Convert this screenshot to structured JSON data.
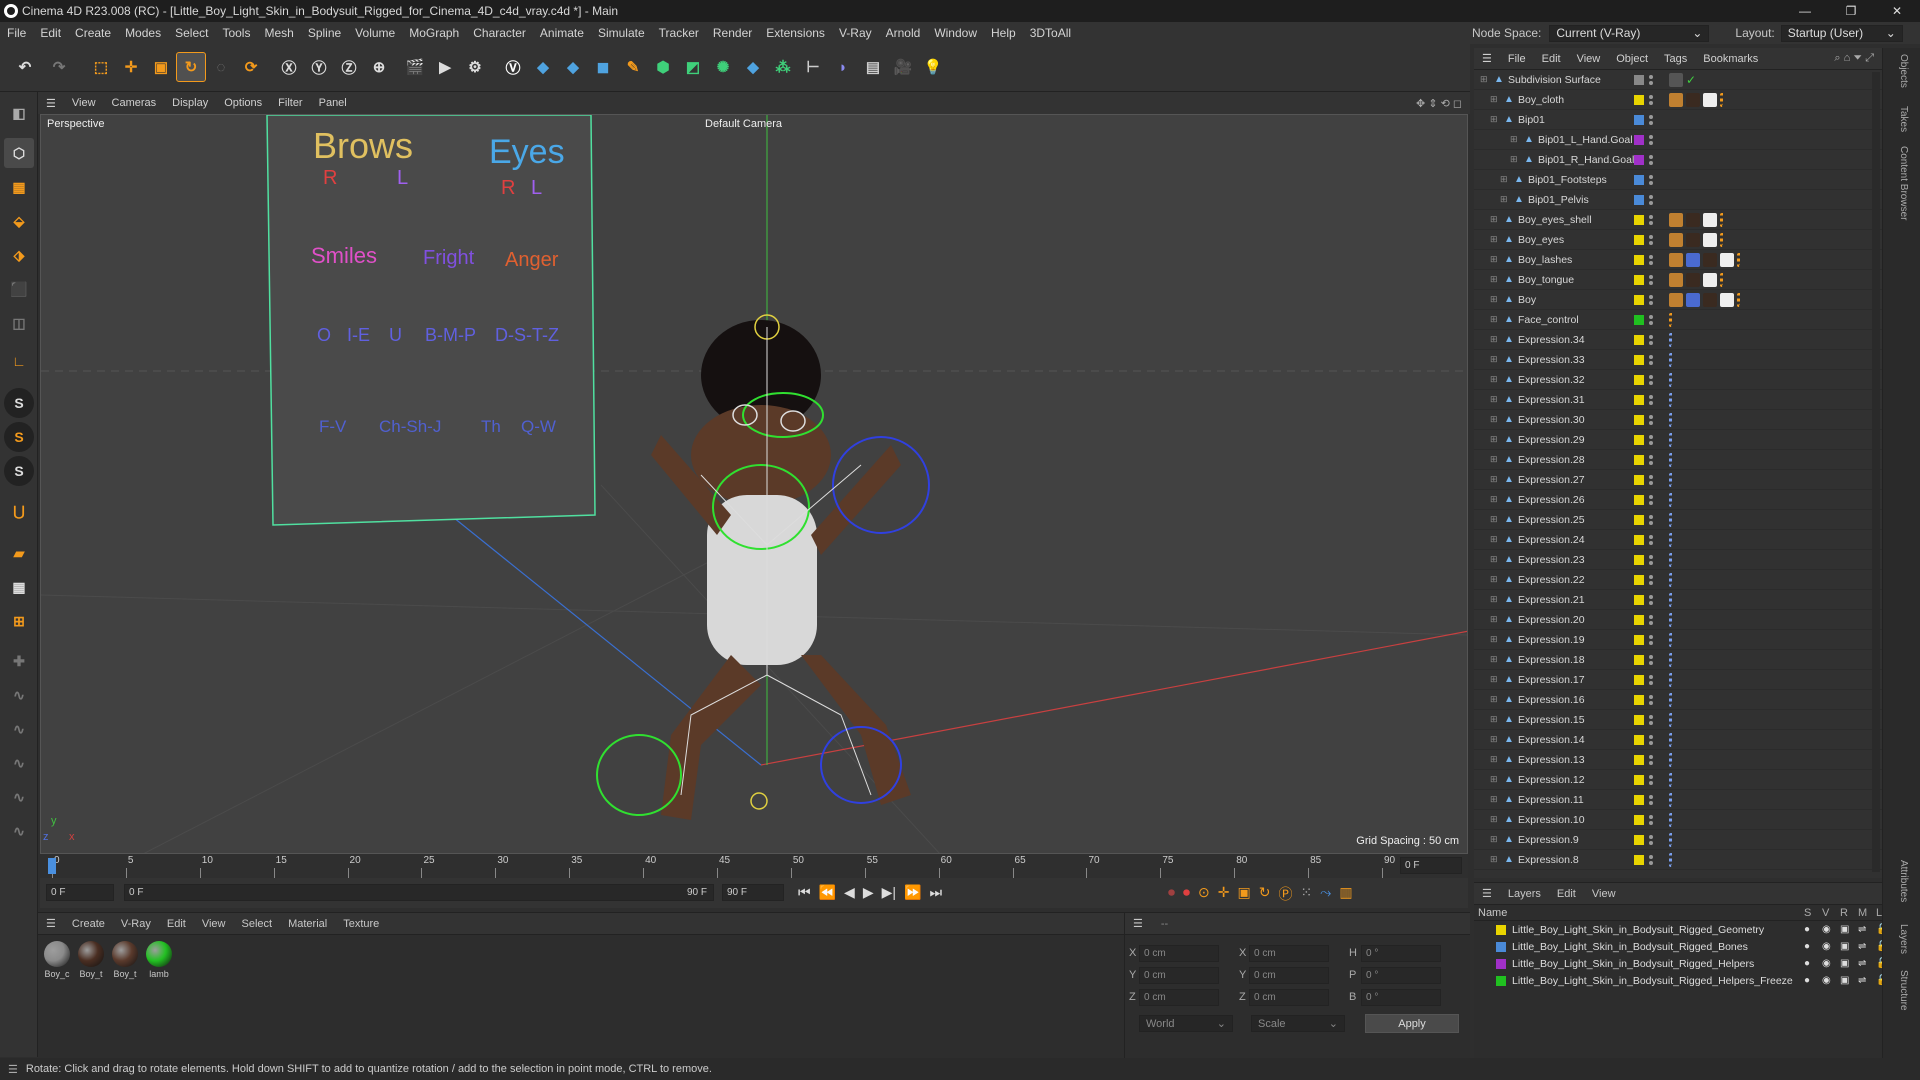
{
  "window": {
    "title": "Cinema 4D R23.008 (RC) - [Little_Boy_Light_Skin_in_Bodysuit_Rigged_for_Cinema_4D_c4d_vray.c4d *] - Main",
    "controls": [
      "—",
      "❐",
      "✕"
    ]
  },
  "menu": [
    "File",
    "Edit",
    "Create",
    "Modes",
    "Select",
    "Tools",
    "Mesh",
    "Spline",
    "Volume",
    "MoGraph",
    "Character",
    "Animate",
    "Simulate",
    "Tracker",
    "Render",
    "Extensions",
    "V-Ray",
    "Arnold",
    "Window",
    "Help",
    "3DToAll"
  ],
  "nodespace": {
    "label": "Node Space:",
    "value": "Current (V-Ray)",
    "layout_label": "Layout:",
    "layout_value": "Startup (User)"
  },
  "viewport": {
    "menu": [
      "View",
      "Cameras",
      "Display",
      "Options",
      "Filter",
      "Panel"
    ],
    "label": "Perspective",
    "camera": "Default Camera",
    "grid_spacing": "Grid Spacing : 50 cm",
    "board": {
      "brows": "Brows",
      "eyes": "Eyes",
      "r1": "R",
      "l1": "L",
      "r2": "R",
      "l2": "L",
      "smiles": "Smiles",
      "fright": "Fright",
      "anger": "Anger",
      "o": "O",
      "ie": "I-E",
      "u": "U",
      "bmp": "B-M-P",
      "dstz": "D-S-T-Z",
      "fv": "F-V",
      "chshj": "Ch-Sh-J",
      "th": "Th",
      "qw": "Q-W"
    },
    "axis": {
      "x": "x",
      "y": "y",
      "z": "z"
    }
  },
  "timeline": {
    "ticks": [
      "0",
      "5",
      "10",
      "15",
      "20",
      "25",
      "30",
      "35",
      "40",
      "45",
      "50",
      "55",
      "60",
      "65",
      "70",
      "75",
      "80",
      "85",
      "90"
    ],
    "end_field": "0 F"
  },
  "transport": {
    "start": "0 F",
    "current": "0 F",
    "end_left": "90 F",
    "end_right": "90 F"
  },
  "materials": {
    "menu": [
      "Create",
      "V-Ray",
      "Edit",
      "View",
      "Select",
      "Material",
      "Texture"
    ],
    "items": [
      {
        "label": "Boy_c",
        "color": "#8a8a8a"
      },
      {
        "label": "Boy_t",
        "color": "#4a2e22"
      },
      {
        "label": "Boy_t",
        "color": "#5a3a2c"
      },
      {
        "label": "lamb",
        "color": "#22c022"
      }
    ]
  },
  "attributes": {
    "header": "--",
    "rows": [
      {
        "a": "X",
        "av": "0 cm",
        "b": "X",
        "bv": "0 cm",
        "c": "H",
        "cv": "0 °"
      },
      {
        "a": "Y",
        "av": "0 cm",
        "b": "Y",
        "bv": "0 cm",
        "c": "P",
        "cv": "0 °"
      },
      {
        "a": "Z",
        "av": "0 cm",
        "b": "Z",
        "bv": "0 cm",
        "c": "B",
        "cv": "0 °"
      }
    ],
    "coord": "World",
    "mode": "Scale",
    "apply": "Apply"
  },
  "status": "Rotate: Click and drag to rotate elements. Hold down SHIFT to add to quantize rotation / add to the selection in point mode, CTRL to remove.",
  "objects": {
    "menu": [
      "File",
      "Edit",
      "View",
      "Object",
      "Tags",
      "Bookmarks"
    ],
    "rows": [
      {
        "name": "Subdivision Surface",
        "indent": 0,
        "color": "#888888",
        "tags": "check"
      },
      {
        "name": "Boy_cloth",
        "indent": 1,
        "color": "#e8d400",
        "tags": "mat4"
      },
      {
        "name": "Bip01",
        "indent": 1,
        "color": "#4a8ad8",
        "tags": ""
      },
      {
        "name": "Bip01_L_Hand.Goal",
        "indent": 3,
        "color": "#a030c8",
        "tags": ""
      },
      {
        "name": "Bip01_R_Hand.Goal",
        "indent": 3,
        "color": "#a030c8",
        "tags": ""
      },
      {
        "name": "Bip01_Footsteps",
        "indent": 2,
        "color": "#4a8ad8",
        "tags": ""
      },
      {
        "name": "Bip01_Pelvis",
        "indent": 2,
        "color": "#4a8ad8",
        "tags": ""
      },
      {
        "name": "Boy_eyes_shell",
        "indent": 1,
        "color": "#e8d400",
        "tags": "mat4"
      },
      {
        "name": "Boy_eyes",
        "indent": 1,
        "color": "#e8d400",
        "tags": "mat4"
      },
      {
        "name": "Boy_lashes",
        "indent": 1,
        "color": "#e8d400",
        "tags": "mat5"
      },
      {
        "name": "Boy_tongue",
        "indent": 1,
        "color": "#e8d400",
        "tags": "mat4"
      },
      {
        "name": "Boy",
        "indent": 1,
        "color": "#e8d400",
        "tags": "mat5"
      },
      {
        "name": "Face_control",
        "indent": 1,
        "color": "#20c020",
        "tags": "one"
      },
      {
        "name": "Expression.34",
        "indent": 1,
        "color": "#e8d400",
        "tags": "expr"
      },
      {
        "name": "Expression.33",
        "indent": 1,
        "color": "#e8d400",
        "tags": "expr"
      },
      {
        "name": "Expression.32",
        "indent": 1,
        "color": "#e8d400",
        "tags": "expr"
      },
      {
        "name": "Expression.31",
        "indent": 1,
        "color": "#e8d400",
        "tags": "expr"
      },
      {
        "name": "Expression.30",
        "indent": 1,
        "color": "#e8d400",
        "tags": "expr"
      },
      {
        "name": "Expression.29",
        "indent": 1,
        "color": "#e8d400",
        "tags": "expr"
      },
      {
        "name": "Expression.28",
        "indent": 1,
        "color": "#e8d400",
        "tags": "expr"
      },
      {
        "name": "Expression.27",
        "indent": 1,
        "color": "#e8d400",
        "tags": "expr"
      },
      {
        "name": "Expression.26",
        "indent": 1,
        "color": "#e8d400",
        "tags": "expr"
      },
      {
        "name": "Expression.25",
        "indent": 1,
        "color": "#e8d400",
        "tags": "expr"
      },
      {
        "name": "Expression.24",
        "indent": 1,
        "color": "#e8d400",
        "tags": "expr"
      },
      {
        "name": "Expression.23",
        "indent": 1,
        "color": "#e8d400",
        "tags": "expr"
      },
      {
        "name": "Expression.22",
        "indent": 1,
        "color": "#e8d400",
        "tags": "expr"
      },
      {
        "name": "Expression.21",
        "indent": 1,
        "color": "#e8d400",
        "tags": "expr"
      },
      {
        "name": "Expression.20",
        "indent": 1,
        "color": "#e8d400",
        "tags": "expr"
      },
      {
        "name": "Expression.19",
        "indent": 1,
        "color": "#e8d400",
        "tags": "expr"
      },
      {
        "name": "Expression.18",
        "indent": 1,
        "color": "#e8d400",
        "tags": "expr"
      },
      {
        "name": "Expression.17",
        "indent": 1,
        "color": "#e8d400",
        "tags": "expr"
      },
      {
        "name": "Expression.16",
        "indent": 1,
        "color": "#e8d400",
        "tags": "expr"
      },
      {
        "name": "Expression.15",
        "indent": 1,
        "color": "#e8d400",
        "tags": "expr"
      },
      {
        "name": "Expression.14",
        "indent": 1,
        "color": "#e8d400",
        "tags": "expr"
      },
      {
        "name": "Expression.13",
        "indent": 1,
        "color": "#e8d400",
        "tags": "expr"
      },
      {
        "name": "Expression.12",
        "indent": 1,
        "color": "#e8d400",
        "tags": "expr"
      },
      {
        "name": "Expression.11",
        "indent": 1,
        "color": "#e8d400",
        "tags": "expr"
      },
      {
        "name": "Expression.10",
        "indent": 1,
        "color": "#e8d400",
        "tags": "expr"
      },
      {
        "name": "Expression.9",
        "indent": 1,
        "color": "#e8d400",
        "tags": "expr"
      },
      {
        "name": "Expression.8",
        "indent": 1,
        "color": "#e8d400",
        "tags": "expr"
      }
    ]
  },
  "layers": {
    "menu": [
      "Layers",
      "Edit",
      "View"
    ],
    "col_name": "Name",
    "cols": [
      "S",
      "V",
      "R",
      "M",
      "L"
    ],
    "rows": [
      {
        "name": "Little_Boy_Light_Skin_in_Bodysuit_Rigged_Geometry",
        "color": "#e8d400"
      },
      {
        "name": "Little_Boy_Light_Skin_in_Bodysuit_Rigged_Bones",
        "color": "#4a8ad8"
      },
      {
        "name": "Little_Boy_Light_Skin_in_Bodysuit_Rigged_Helpers",
        "color": "#a030c8"
      },
      {
        "name": "Little_Boy_Light_Skin_in_Bodysuit_Rigged_Helpers_Freeze",
        "color": "#20c020"
      }
    ]
  },
  "side_tabs": [
    "Objects",
    "Takes",
    "Content Browser",
    "Attributes",
    "Layers",
    "Structure"
  ]
}
